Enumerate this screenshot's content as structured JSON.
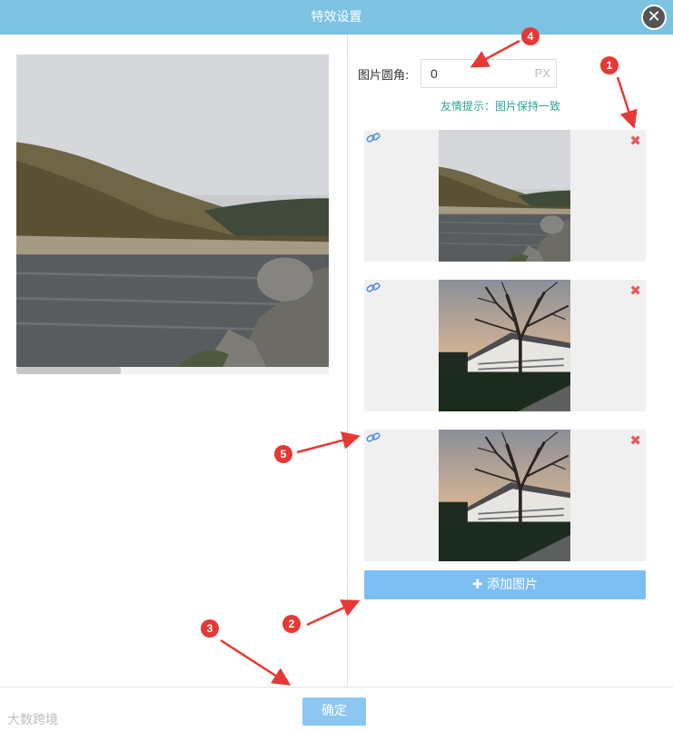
{
  "dialog": {
    "title": "特效设置",
    "close_glyph": "✕"
  },
  "radius": {
    "label": "图片圆角:",
    "value": "0",
    "unit": "PX"
  },
  "hint": "友情提示：图片保持一致",
  "images": [
    {
      "scene": "lake-hills",
      "link_icon": "link-icon",
      "delete_icon": "close-x-icon",
      "delete_glyph": "✖"
    },
    {
      "scene": "tree-building",
      "link_icon": "link-icon",
      "delete_icon": "close-x-icon",
      "delete_glyph": "✖"
    },
    {
      "scene": "tree-building",
      "link_icon": "link-icon",
      "delete_icon": "close-x-icon",
      "delete_glyph": "✖"
    }
  ],
  "add_button": {
    "icon": "plus-icon",
    "label": "✚ 添加图片"
  },
  "ok_button": {
    "label": "确定"
  },
  "annotations": [
    "1",
    "2",
    "3",
    "4",
    "5"
  ],
  "watermark": "大数跨境",
  "colors": {
    "titlebar": "#7cc3e2",
    "accent": "#7dbef2",
    "hint": "#2aa39a",
    "annotation": "#e53935",
    "delete": "#e25b5b"
  }
}
